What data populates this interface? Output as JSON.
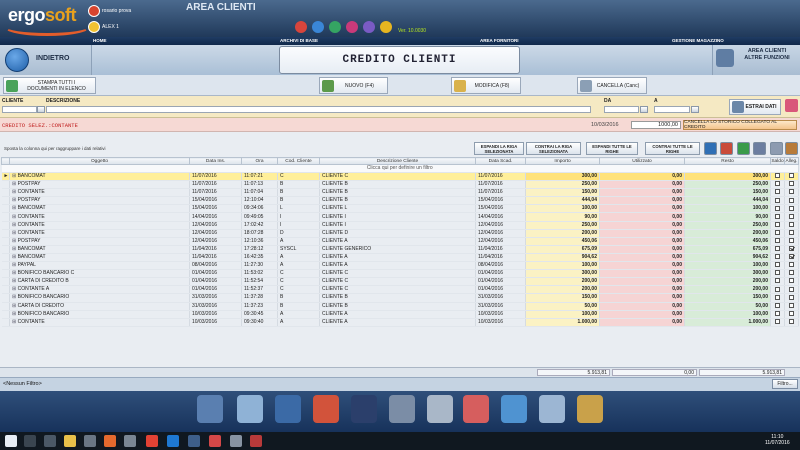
{
  "header": {
    "logo_main": "ergo",
    "logo_accent": "soft",
    "user1": "rosario prova",
    "user2": "ALEX 1",
    "area_title": "AREA CLIENTI",
    "version": "Ver. 10.0030"
  },
  "nav": {
    "home": "HOME",
    "archivi": "ARCHIVI DI BASE",
    "fornitori": "AREA FORNITORI",
    "magazzino": "GESTIONE MAGAZZINO"
  },
  "titlebar": {
    "back": "INDIETRO",
    "title": "CREDITO CLIENTI",
    "altre_line1": "AREA CLIENTI",
    "altre_line2": "ALTRE FUNZIONI"
  },
  "toolbar": {
    "stampa_line1": "STAMPA TUTTI I",
    "stampa_line2": "DOCUMENTI IN ELENCO",
    "nuovo": "NUOVO (F4)",
    "modifica": "MODIFICA (F8)",
    "cancella": "CANCELLA (Canc)"
  },
  "filter": {
    "cliente": "CLIENTE",
    "descrizione": "DESCRIZIONE",
    "da": "DA",
    "a": "A",
    "estrai": "ESTRAI DATI"
  },
  "credito": {
    "label": "CREDITO SELEZ.:CONTANTE",
    "date": "10/03/2016",
    "amount": "1000,00",
    "cancella_storico": "CANCELLA LO STORICO COLLEGATO AL CREDITO"
  },
  "grid_tools": {
    "group_hint": "Sposta la colonna qui per raggruppare i dati relativi",
    "espandi_riga": "ESPANDI LA RIGA SELEZIONATA",
    "contrai_riga": "CONTRAI LA RIGA SELEZIONATA",
    "espandi_tutte": "ESPANDI TUTTE LE RIGHE",
    "contrai_tutte": "CONTRAI TUTTE LE RIGHE"
  },
  "columns": [
    "Oggetto",
    "Data Ins.",
    "Ora",
    "Cod. Cliente",
    "Descrizione Cliente",
    "Data Scad.",
    "Importo",
    "Utilizzato",
    "Resto",
    "Saldo",
    "Alleg."
  ],
  "filter_hint": "Clicca qui per definire un filtro",
  "rows": [
    {
      "oggetto": "BANCOMAT",
      "data": "11/07/2016",
      "ora": "11:07:21",
      "cod": "C",
      "desc": "CLIENTE C",
      "scad": "11/07/2016",
      "imp": "300,00",
      "uti": "0,00",
      "res": "300,00",
      "saldo": false,
      "alleg": false
    },
    {
      "oggetto": "POSTPAY",
      "data": "11/07/2016",
      "ora": "11:07:13",
      "cod": "B",
      "desc": "CLIENTE B",
      "scad": "11/07/2016",
      "imp": "250,00",
      "uti": "0,00",
      "res": "250,00",
      "saldo": false,
      "alleg": false
    },
    {
      "oggetto": "CONTANTE",
      "data": "11/07/2016",
      "ora": "11:07:04",
      "cod": "B",
      "desc": "CLIENTE B",
      "scad": "11/07/2016",
      "imp": "150,00",
      "uti": "0,00",
      "res": "150,00",
      "saldo": false,
      "alleg": false
    },
    {
      "oggetto": "POSTPAY",
      "data": "15/04/2016",
      "ora": "12:10:04",
      "cod": "B",
      "desc": "CLIENTE B",
      "scad": "15/04/2016",
      "imp": "444,04",
      "uti": "0,00",
      "res": "444,04",
      "saldo": false,
      "alleg": false
    },
    {
      "oggetto": "BANCOMAT",
      "data": "15/04/2016",
      "ora": "09:34:06",
      "cod": "L",
      "desc": "CLIENTE L",
      "scad": "15/04/2016",
      "imp": "100,00",
      "uti": "0,00",
      "res": "100,00",
      "saldo": false,
      "alleg": false
    },
    {
      "oggetto": "CONTANTE",
      "data": "14/04/2016",
      "ora": "09:49:05",
      "cod": "I",
      "desc": "CLIENTE I",
      "scad": "14/04/2016",
      "imp": "90,00",
      "uti": "0,00",
      "res": "90,00",
      "saldo": false,
      "alleg": false
    },
    {
      "oggetto": "CONTANTE",
      "data": "12/04/2016",
      "ora": "17:02:42",
      "cod": "I",
      "desc": "CLIENTE I",
      "scad": "12/04/2016",
      "imp": "250,00",
      "uti": "0,00",
      "res": "250,00",
      "saldo": false,
      "alleg": false
    },
    {
      "oggetto": "CONTANTE",
      "data": "12/04/2016",
      "ora": "18:07:28",
      "cod": "D",
      "desc": "CLIENTE D",
      "scad": "12/04/2016",
      "imp": "200,00",
      "uti": "0,00",
      "res": "200,00",
      "saldo": false,
      "alleg": false
    },
    {
      "oggetto": "POSTPAY",
      "data": "12/04/2016",
      "ora": "12:10:36",
      "cod": "A",
      "desc": "CLIENTE A",
      "scad": "12/04/2016",
      "imp": "450,06",
      "uti": "0,00",
      "res": "450,06",
      "saldo": false,
      "alleg": false
    },
    {
      "oggetto": "BANCOMAT",
      "data": "11/04/2016",
      "ora": "17:28:12",
      "cod": "SYSCL",
      "desc": "CLIENTE GENERICO",
      "scad": "11/04/2016",
      "imp": "675,09",
      "uti": "0,00",
      "res": "675,09",
      "saldo": false,
      "alleg": true
    },
    {
      "oggetto": "BANCOMAT",
      "data": "11/04/2016",
      "ora": "16:42:35",
      "cod": "A",
      "desc": "CLIENTE A",
      "scad": "11/04/2016",
      "imp": "904,62",
      "uti": "0,00",
      "res": "904,62",
      "saldo": false,
      "alleg": true
    },
    {
      "oggetto": "PAYPAL",
      "data": "08/04/2016",
      "ora": "11:27:30",
      "cod": "A",
      "desc": "CLIENTE A",
      "scad": "08/04/2016",
      "imp": "100,00",
      "uti": "0,00",
      "res": "100,00",
      "saldo": false,
      "alleg": false
    },
    {
      "oggetto": "BONIFICO BANCARIO C",
      "data": "01/04/2016",
      "ora": "11:53:02",
      "cod": "C",
      "desc": "CLIENTE C",
      "scad": "01/04/2016",
      "imp": "300,00",
      "uti": "0,00",
      "res": "300,00",
      "saldo": false,
      "alleg": false
    },
    {
      "oggetto": "CARTA DI CREDITO B",
      "data": "01/04/2016",
      "ora": "11:52:54",
      "cod": "C",
      "desc": "CLIENTE C",
      "scad": "01/04/2016",
      "imp": "200,00",
      "uti": "0,00",
      "res": "200,00",
      "saldo": false,
      "alleg": false
    },
    {
      "oggetto": "CONTANTE A",
      "data": "01/04/2016",
      "ora": "11:52:37",
      "cod": "C",
      "desc": "CLIENTE C",
      "scad": "01/04/2016",
      "imp": "200,00",
      "uti": "0,00",
      "res": "200,00",
      "saldo": false,
      "alleg": false
    },
    {
      "oggetto": "BONIFICO BANCARIO",
      "data": "31/03/2016",
      "ora": "11:37:28",
      "cod": "B",
      "desc": "CLIENTE B",
      "scad": "31/03/2016",
      "imp": "150,00",
      "uti": "0,00",
      "res": "150,00",
      "saldo": false,
      "alleg": false
    },
    {
      "oggetto": "CARTA DI CREDITO",
      "data": "31/03/2016",
      "ora": "11:37:23",
      "cod": "B",
      "desc": "CLIENTE B",
      "scad": "31/03/2016",
      "imp": "50,00",
      "uti": "0,00",
      "res": "50,00",
      "saldo": false,
      "alleg": false
    },
    {
      "oggetto": "BONIFICO BANCARIO",
      "data": "10/03/2016",
      "ora": "09:30:45",
      "cod": "A",
      "desc": "CLIENTE A",
      "scad": "10/03/2016",
      "imp": "100,00",
      "uti": "0,00",
      "res": "100,00",
      "saldo": false,
      "alleg": false
    },
    {
      "oggetto": "CONTANTE",
      "data": "10/03/2016",
      "ora": "09:30:40",
      "cod": "A",
      "desc": "CLIENTE A",
      "scad": "10/03/2016",
      "imp": "1.000,00",
      "uti": "0,00",
      "res": "1.000,00",
      "saldo": false,
      "alleg": false
    }
  ],
  "totals": {
    "importo": "5.913,81",
    "utilizzato": "0,00",
    "resto": "5.913,81"
  },
  "status": {
    "filter": "<Nessun Filtro>",
    "filtro_btn": "Filtro..."
  },
  "taskbar": {
    "time": "11:10",
    "date": "11/07/2016"
  }
}
